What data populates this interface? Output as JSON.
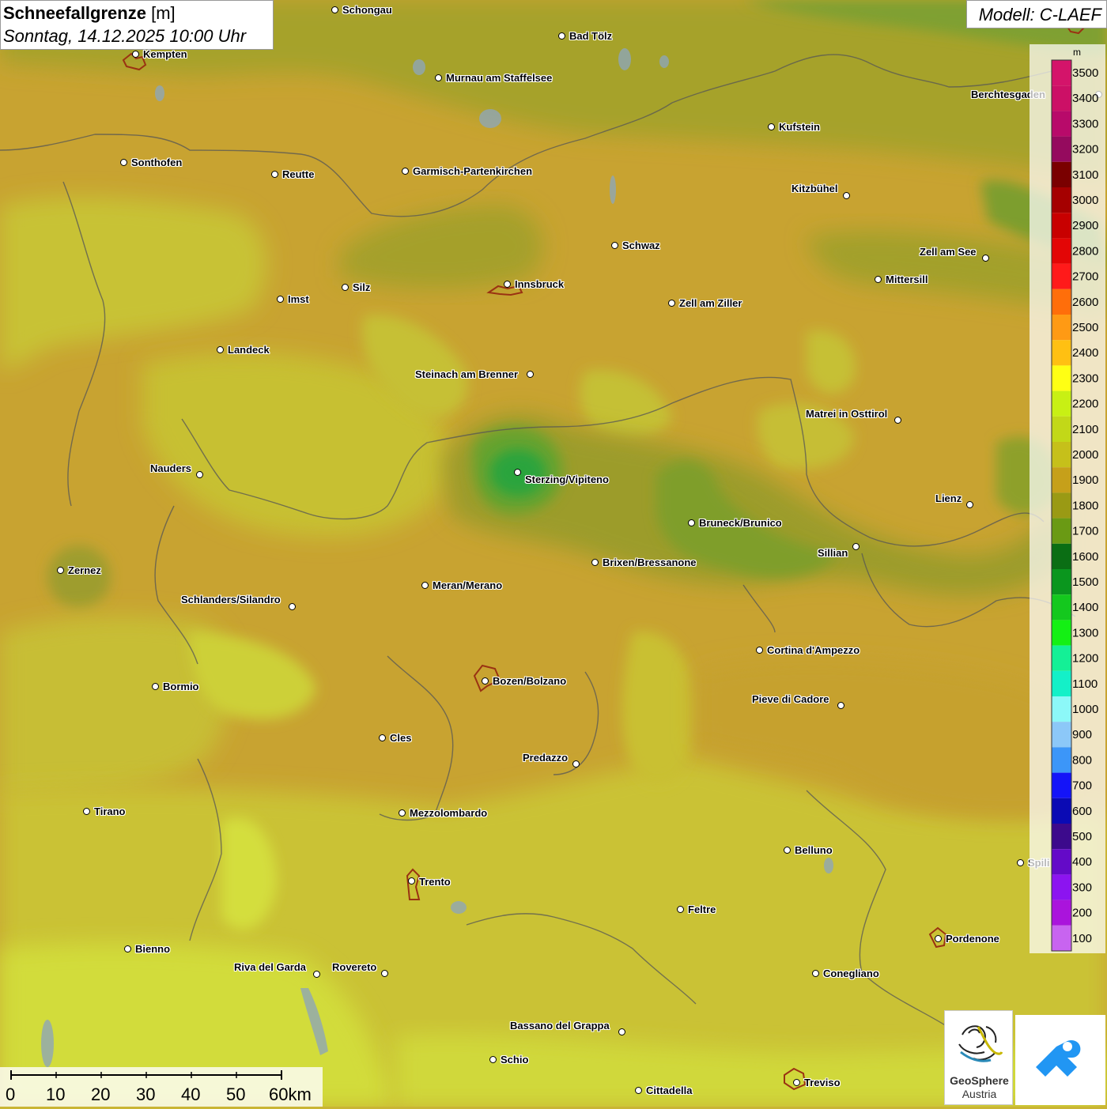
{
  "header": {
    "title": "Schneefallgrenze",
    "unit": "[m]",
    "datetime": "Sonntag, 14.12.2025 10:00 Uhr",
    "model": "Modell: C-LAEF"
  },
  "legend": {
    "unit": "m",
    "levels": [
      {
        "value": "3500",
        "color": "#d4146a"
      },
      {
        "value": "3400",
        "color": "#cc1066"
      },
      {
        "value": "3300",
        "color": "#b80a6a"
      },
      {
        "value": "3200",
        "color": "#950a5e"
      },
      {
        "value": "3100",
        "color": "#7a0000"
      },
      {
        "value": "3000",
        "color": "#a50000"
      },
      {
        "value": "2900",
        "color": "#c80000"
      },
      {
        "value": "2800",
        "color": "#e30606"
      },
      {
        "value": "2700",
        "color": "#ff1a1a"
      },
      {
        "value": "2600",
        "color": "#ff6e0a"
      },
      {
        "value": "2500",
        "color": "#ff9a14"
      },
      {
        "value": "2400",
        "color": "#ffc012"
      },
      {
        "value": "2300",
        "color": "#ffff14"
      },
      {
        "value": "2200",
        "color": "#c8f014"
      },
      {
        "value": "2100",
        "color": "#c2d818"
      },
      {
        "value": "2000",
        "color": "#c6c01a"
      },
      {
        "value": "1900",
        "color": "#c6a01a"
      },
      {
        "value": "1800",
        "color": "#9a9a14"
      },
      {
        "value": "1700",
        "color": "#6a9a14"
      },
      {
        "value": "1600",
        "color": "#0a6e14"
      },
      {
        "value": "1500",
        "color": "#0a961e"
      },
      {
        "value": "1400",
        "color": "#14c81e"
      },
      {
        "value": "1300",
        "color": "#14f014"
      },
      {
        "value": "1200",
        "color": "#14f096"
      },
      {
        "value": "1100",
        "color": "#14f0c8"
      },
      {
        "value": "1000",
        "color": "#8cf8f8"
      },
      {
        "value": "900",
        "color": "#8cc8f8"
      },
      {
        "value": "800",
        "color": "#3c96f8"
      },
      {
        "value": "700",
        "color": "#1414f8"
      },
      {
        "value": "600",
        "color": "#0a0ab4"
      },
      {
        "value": "500",
        "color": "#3c0a8c"
      },
      {
        "value": "400",
        "color": "#640ac8"
      },
      {
        "value": "300",
        "color": "#8c14f0"
      },
      {
        "value": "200",
        "color": "#aa14dc"
      },
      {
        "value": "100",
        "color": "#c864f0"
      }
    ]
  },
  "cities": [
    {
      "name": "Schongau"
    },
    {
      "name": "Bad Tölz"
    },
    {
      "name": "Kempten"
    },
    {
      "name": "Murnau am Staffelsee"
    },
    {
      "name": "Berchtesgaden"
    },
    {
      "name": "Kufstein"
    },
    {
      "name": "Sonthofen"
    },
    {
      "name": "Reutte"
    },
    {
      "name": "Garmisch-Partenkirchen"
    },
    {
      "name": "Kitzbühel"
    },
    {
      "name": "Schwaz"
    },
    {
      "name": "Zell am See"
    },
    {
      "name": "Mittersill"
    },
    {
      "name": "Imst"
    },
    {
      "name": "Silz"
    },
    {
      "name": "Innsbruck"
    },
    {
      "name": "Zell am Ziller"
    },
    {
      "name": "Landeck"
    },
    {
      "name": "Steinach am Brenner"
    },
    {
      "name": "Matrei in Osttirol"
    },
    {
      "name": "Nauders"
    },
    {
      "name": "Sterzing/Vipiteno"
    },
    {
      "name": "Lienz"
    },
    {
      "name": "Bruneck/Brunico"
    },
    {
      "name": "Sillian"
    },
    {
      "name": "Zernez"
    },
    {
      "name": "Brixen/Bressanone"
    },
    {
      "name": "Meran/Merano"
    },
    {
      "name": "Schlanders/Silandro"
    },
    {
      "name": "Cortina d'Ampezzo"
    },
    {
      "name": "Bormio"
    },
    {
      "name": "Bozen/Bolzano"
    },
    {
      "name": "Pieve di Cadore"
    },
    {
      "name": "Cles"
    },
    {
      "name": "Predazzo"
    },
    {
      "name": "Tirano"
    },
    {
      "name": "Mezzolombardo"
    },
    {
      "name": "Belluno"
    },
    {
      "name": "Spili"
    },
    {
      "name": "Trento"
    },
    {
      "name": "Feltre"
    },
    {
      "name": "Pordenone"
    },
    {
      "name": "Bienno"
    },
    {
      "name": "Riva del Garda"
    },
    {
      "name": "Rovereto"
    },
    {
      "name": "Conegliano"
    },
    {
      "name": "Bassano del Grappa"
    },
    {
      "name": "Schio"
    },
    {
      "name": "Treviso"
    },
    {
      "name": "Cittadella"
    }
  ],
  "scale": {
    "ticks": [
      "0",
      "10",
      "20",
      "30",
      "40",
      "50",
      "60km"
    ]
  },
  "logos": {
    "geosphere_line1": "GeoSphere",
    "geosphere_line2": "Austria"
  }
}
